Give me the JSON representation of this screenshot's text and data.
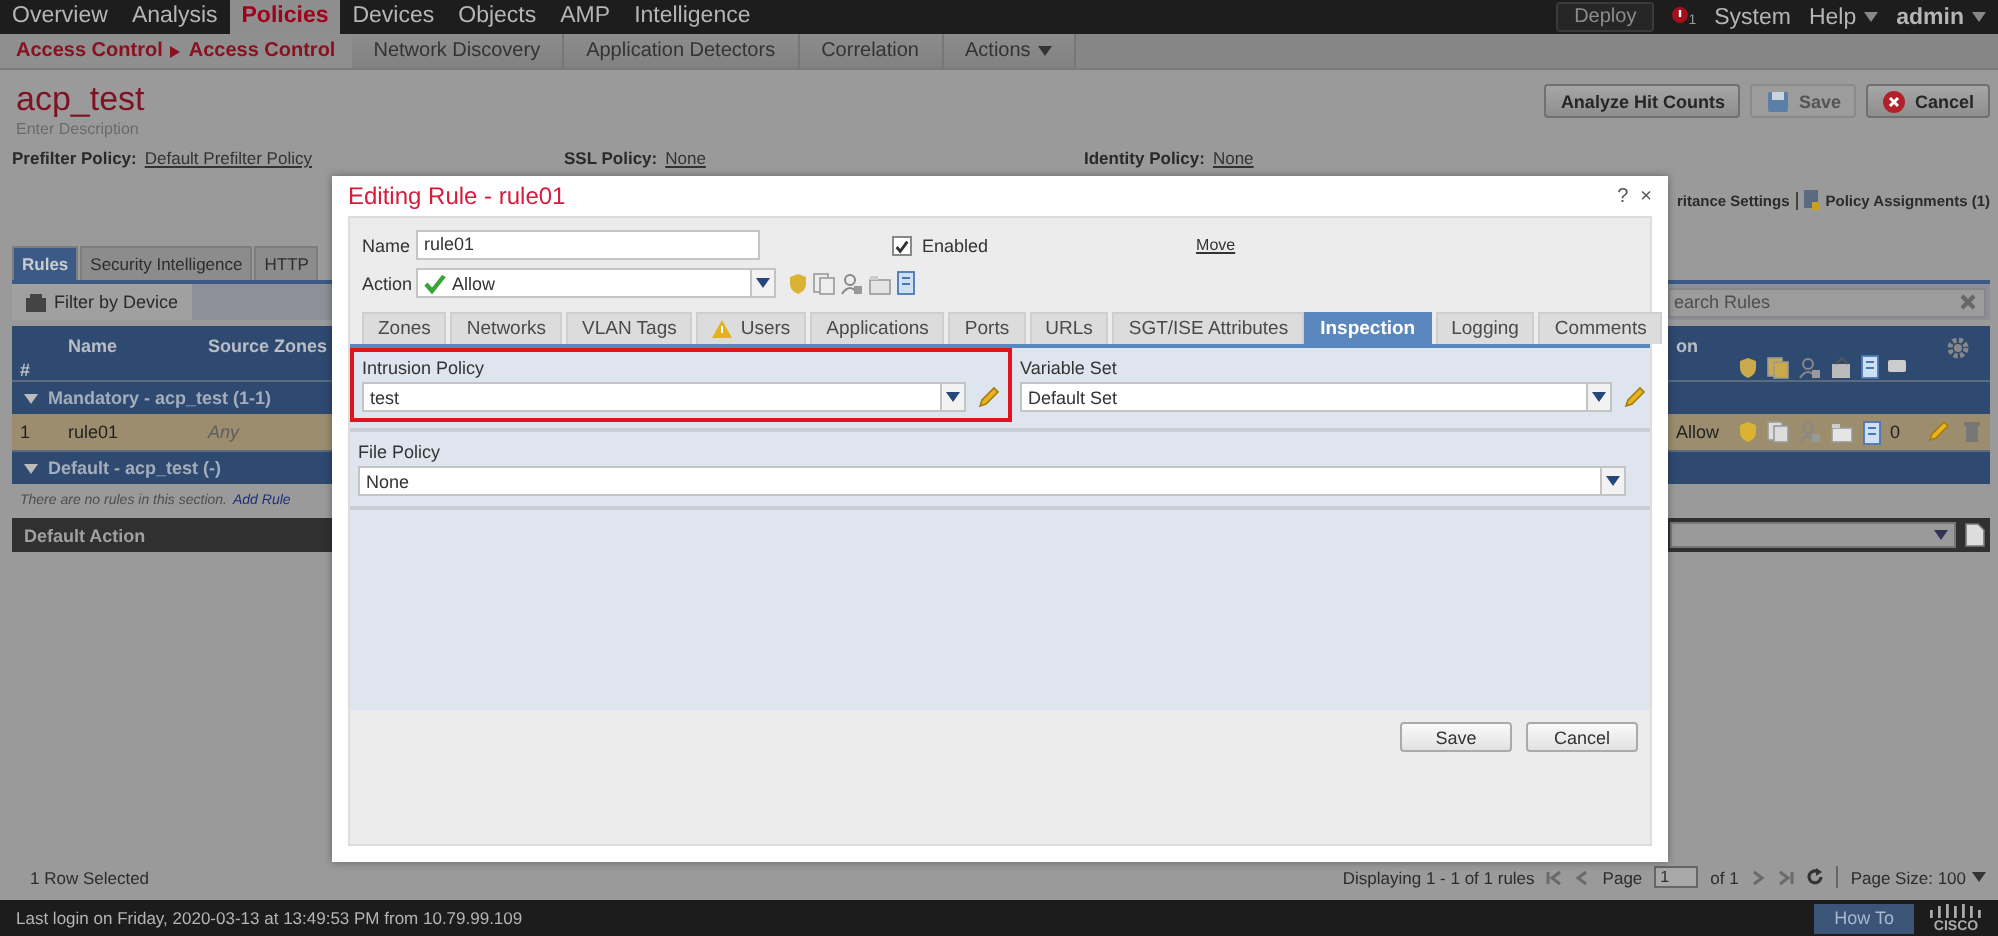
{
  "top_nav": {
    "items": [
      {
        "label": "Overview",
        "selected": false
      },
      {
        "label": "Analysis",
        "selected": false
      },
      {
        "label": "Policies",
        "selected": true
      },
      {
        "label": "Devices",
        "selected": false
      },
      {
        "label": "Objects",
        "selected": false
      },
      {
        "label": "AMP",
        "selected": false
      },
      {
        "label": "Intelligence",
        "selected": false
      }
    ],
    "deploy": "Deploy",
    "alert_count": "1",
    "system": "System",
    "help": "Help",
    "user": "admin"
  },
  "sub_nav": {
    "breadcrumb": [
      "Access Control",
      "Access Control"
    ],
    "items": [
      "Network Discovery",
      "Application Detectors",
      "Correlation",
      "Actions"
    ]
  },
  "policy": {
    "name": "acp_test",
    "description": "Enter Description",
    "prefilter_label": "Prefilter Policy:",
    "prefilter_value": "Default Prefilter Policy",
    "ssl_label": "SSL Policy:",
    "ssl_value": "None",
    "identity_label": "Identity Policy:",
    "identity_value": "None"
  },
  "header_buttons": [
    {
      "label": "Analyze Hit Counts",
      "kind": "plain",
      "disabled": false
    },
    {
      "label": "Save",
      "kind": "save",
      "disabled": true
    },
    {
      "label": "Cancel",
      "kind": "cancel",
      "disabled": false
    }
  ],
  "policy_links": [
    "ritance Settings",
    "Policy Assignments (1)"
  ],
  "policy_tabs": [
    {
      "label": "Rules",
      "selected": true
    },
    {
      "label": "Security Intelligence",
      "selected": false
    },
    {
      "label": "HTTP",
      "selected": false
    }
  ],
  "filter_button": "Filter by Device",
  "search": {
    "placeholder": "earch Rules"
  },
  "rules_table": {
    "columns": [
      "#",
      "Name",
      "Source Zones",
      "on"
    ],
    "sections": [
      {
        "title": "Mandatory - acp_test (1-1)",
        "expanded": true,
        "rows": [
          {
            "number": "1",
            "name": "rule01",
            "source_zones": "Any",
            "action": "Allow",
            "hit_count": "0",
            "selected": true
          }
        ]
      },
      {
        "title": "Default - acp_test (-)",
        "expanded": true,
        "empty_text": "There are no rules in this section.",
        "add_link": "Add Rule"
      }
    ]
  },
  "default_action": {
    "label": "Default Action"
  },
  "status": {
    "selection": "1 Row Selected",
    "displaying": "Displaying 1 - 1 of 1 rules",
    "page_label": "Page",
    "page_value": "1",
    "page_total": "of 1",
    "page_size": "Page Size: 100"
  },
  "footer": {
    "last_login": "Last login on Friday, 2020-03-13 at 13:49:53 PM from 10.79.99.109",
    "how_to": "How To",
    "logo_text": "CISCO"
  },
  "dialog": {
    "title": "Editing Rule - rule01",
    "help": "?",
    "close": "×",
    "name_label": "Name",
    "name_value": "rule01",
    "enabled_label": "Enabled",
    "enabled": true,
    "move_link": "Move",
    "action_label": "Action",
    "action_value": "Allow",
    "tabs": [
      {
        "label": "Zones",
        "warning": false,
        "selected": false
      },
      {
        "label": "Networks",
        "warning": false,
        "selected": false
      },
      {
        "label": "VLAN Tags",
        "warning": false,
        "selected": false
      },
      {
        "label": "Users",
        "warning": true,
        "selected": false
      },
      {
        "label": "Applications",
        "warning": false,
        "selected": false
      },
      {
        "label": "Ports",
        "warning": false,
        "selected": false
      },
      {
        "label": "URLs",
        "warning": false,
        "selected": false
      },
      {
        "label": "SGT/ISE Attributes",
        "warning": false,
        "selected": false
      }
    ],
    "right_tabs": [
      {
        "label": "Inspection",
        "selected": true
      },
      {
        "label": "Logging",
        "selected": false
      },
      {
        "label": "Comments",
        "selected": false
      }
    ],
    "intrusion": {
      "label": "Intrusion Policy",
      "value": "test",
      "highlighted": true
    },
    "variable_set": {
      "label": "Variable Set",
      "value": "Default Set"
    },
    "file_policy": {
      "label": "File Policy",
      "value": "None"
    },
    "buttons": [
      "Save",
      "Cancel"
    ]
  }
}
